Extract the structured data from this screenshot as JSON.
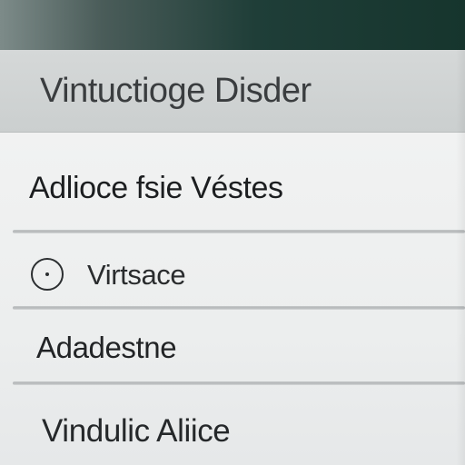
{
  "window": {
    "title": "Vintuctioge Disder"
  },
  "list": {
    "items": [
      {
        "label": "Adlioce fsie Véstes"
      },
      {
        "label": "Virtsace",
        "selected": false
      },
      {
        "label": "Adadestne"
      },
      {
        "label": "Vindulic Aliice"
      }
    ]
  },
  "icons": {
    "radio": "radio-button-icon"
  },
  "colors": {
    "titlebar": "#cbcfcf",
    "panel": "#eceeee",
    "text": "#202224",
    "backdrop_accent": "#1f3e38"
  }
}
